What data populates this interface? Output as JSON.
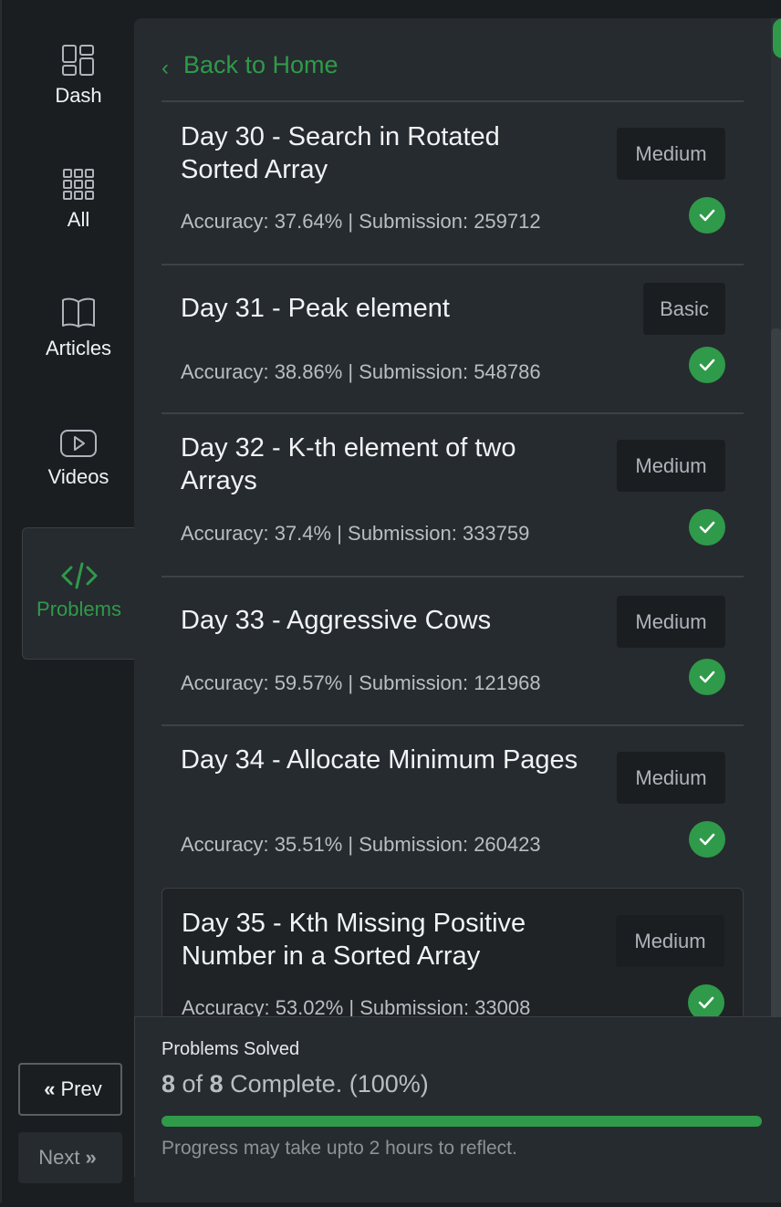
{
  "sidebar": {
    "items": [
      {
        "label": "Dash",
        "icon": "dashboard-icon"
      },
      {
        "label": "All",
        "icon": "grid-icon"
      },
      {
        "label": "Articles",
        "icon": "book-icon"
      },
      {
        "label": "Videos",
        "icon": "play-icon"
      },
      {
        "label": "Problems",
        "icon": "code-icon",
        "active": true
      }
    ],
    "prev_label": "Prev",
    "next_label": "Next"
  },
  "back_link": "Back to Home",
  "problems": [
    {
      "title": "Day 30 - Search in Rotated Sorted Array",
      "stats": "Accuracy: 37.64% | Submission: 259712",
      "difficulty": "Medium",
      "solved": true
    },
    {
      "title": "Day 31 - Peak element",
      "stats": "Accuracy: 38.86% | Submission: 548786",
      "difficulty": "Basic",
      "solved": true
    },
    {
      "title": "Day 32 - K-th element of two Arrays",
      "stats": "Accuracy: 37.4% | Submission: 333759",
      "difficulty": "Medium",
      "solved": true
    },
    {
      "title": "Day 33 - Aggressive Cows",
      "stats": "Accuracy: 59.57% | Submission: 121968",
      "difficulty": "Medium",
      "solved": true
    },
    {
      "title": "Day 34 - Allocate Minimum Pages",
      "stats": "Accuracy: 35.51% | Submission: 260423",
      "difficulty": "Medium",
      "solved": true
    },
    {
      "title": "Day 35 - Kth Missing Positive Number in a Sorted Array",
      "stats": "Accuracy: 53.02% | Submission: 33008",
      "difficulty": "Medium",
      "solved": true
    }
  ],
  "progress": {
    "label": "Problems Solved",
    "solved": "8",
    "of_text": "of",
    "total": "8",
    "complete_text": "Complete. (100%)",
    "fraction": 1.0,
    "note": "Progress may take upto 2 hours to reflect."
  },
  "colors": {
    "accent": "#2f9a4a",
    "background": "#1b1e21",
    "panel": "#262b2f"
  }
}
